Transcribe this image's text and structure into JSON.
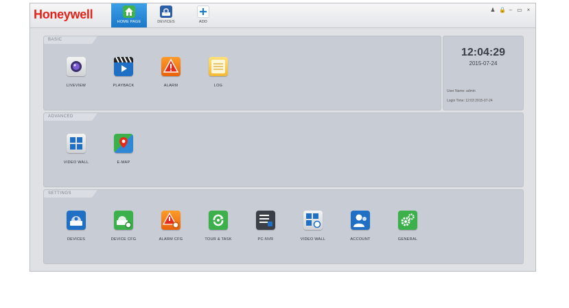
{
  "app": {
    "logo": "Honeywell"
  },
  "nav": [
    {
      "id": "home",
      "label": "HOME PAGE",
      "active": true
    },
    {
      "id": "devices",
      "label": "DEVICES",
      "active": false
    },
    {
      "id": "add",
      "label": "ADD",
      "active": false
    }
  ],
  "window_controls": [
    "user-icon",
    "lock-icon",
    "minimize-icon",
    "restore-icon",
    "close-icon"
  ],
  "window_controls_glyphs": [
    "♟",
    "🔒",
    "–",
    "▭",
    "×"
  ],
  "sections": {
    "basic": {
      "title": "BASIC",
      "items": [
        {
          "label": "LIVEVIEW",
          "icon": "liveview-icon"
        },
        {
          "label": "PLAYBACK",
          "icon": "playback-icon"
        },
        {
          "label": "ALARM",
          "icon": "alarm-icon"
        },
        {
          "label": "LOG",
          "icon": "log-icon"
        }
      ]
    },
    "advanced": {
      "title": "ADVANCED",
      "items": [
        {
          "label": "VIDEO WALL",
          "icon": "video-wall-icon"
        },
        {
          "label": "E-MAP",
          "icon": "emap-icon"
        }
      ]
    },
    "settings": {
      "title": "SETTINGS",
      "items": [
        {
          "label": "DEVICES",
          "icon": "devices-icon"
        },
        {
          "label": "DEVICE CFG",
          "icon": "device-cfg-icon"
        },
        {
          "label": "ALARM CFG",
          "icon": "alarm-cfg-icon"
        },
        {
          "label": "TOUR & TASK",
          "icon": "tour-task-icon"
        },
        {
          "label": "PC-NVR",
          "icon": "pc-nvr-icon"
        },
        {
          "label": "VIDEO WALL",
          "icon": "video-wall-cfg-icon"
        },
        {
          "label": "ACCOUNT",
          "icon": "account-icon"
        },
        {
          "label": "GENERAL",
          "icon": "general-icon"
        }
      ]
    }
  },
  "clock": {
    "time": "12:04:29",
    "date": "2015-07-24",
    "user_name": "User Name: admin",
    "login_time": "Login Time: 12:03 2015-07-24"
  },
  "colors": {
    "brand": "#e2231a",
    "accent": "#1b78c8"
  }
}
